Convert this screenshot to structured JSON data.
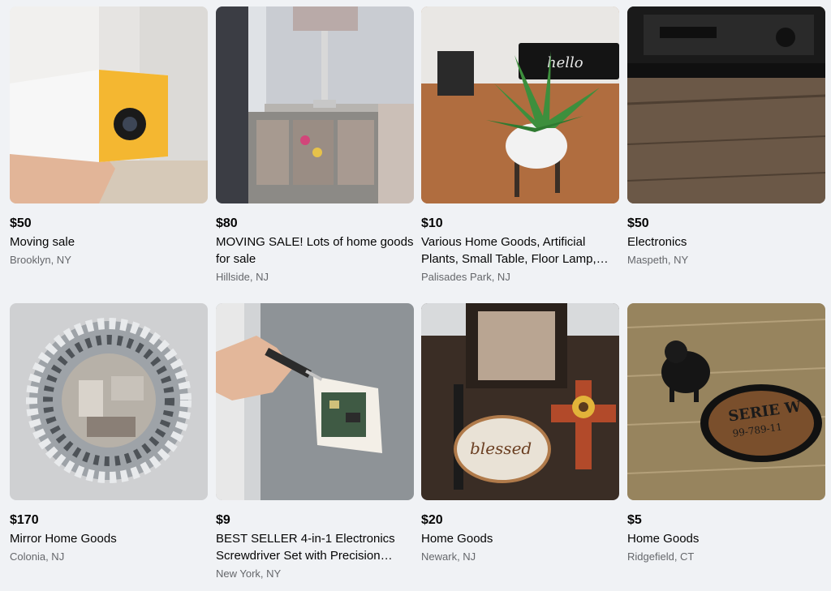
{
  "listings": [
    {
      "price": "$50",
      "title": "Moving sale",
      "location": "Brooklyn, NY",
      "image": "mini-projector"
    },
    {
      "price": "$80",
      "title": "MOVING SALE! Lots of home goods for sale",
      "location": "Hillside, NJ",
      "image": "mirrored-console-table-lamp"
    },
    {
      "price": "$10",
      "title": "Various Home Goods, Artificial Plants, Small Table, Floor Lamp,…",
      "location": "Palisades Park, NJ",
      "image": "artificial-plant-on-stand"
    },
    {
      "price": "$50",
      "title": "Electronics",
      "location": "Maspeth, NY",
      "image": "stereo-receiver"
    },
    {
      "price": "$170",
      "title": "Mirror Home Goods",
      "location": "Colonia, NJ",
      "image": "sunburst-mirror"
    },
    {
      "price": "$9",
      "title": "BEST SELLER 4-in-1 Electronics Screwdriver Set with Precision…",
      "location": "New York, NY",
      "image": "screwdriver-thermostat"
    },
    {
      "price": "$20",
      "title": "Home Goods",
      "location": "Newark, NJ",
      "image": "blessed-pumpkin-decor"
    },
    {
      "price": "$5",
      "title": "Home Goods",
      "location": "Ridgefield, CT",
      "image": "pig-figurine-serving-tray"
    }
  ],
  "image_text": {
    "pumpkin_sign": "blessed",
    "tray_line1": "SERIE W",
    "tray_line2": "99-789-11",
    "doormat": "hello"
  }
}
